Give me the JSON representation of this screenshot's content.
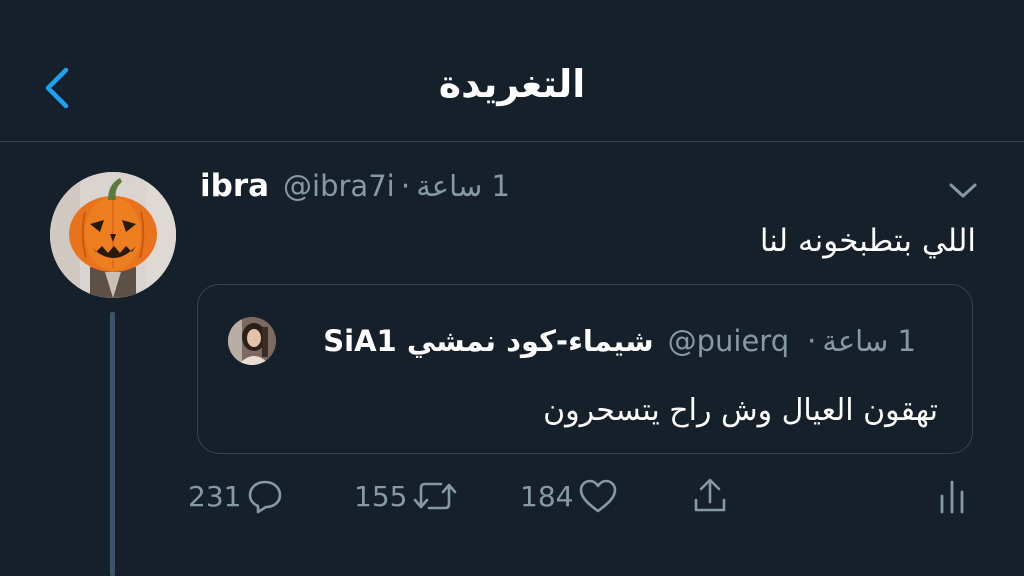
{
  "header": {
    "title": "التغريدة"
  },
  "tweet": {
    "name": "ibra",
    "handle": "@ibra7i",
    "time": "1 ساعة",
    "text": "اللي بتطبخونه لنا",
    "avatar": "pumpkin-avatar"
  },
  "quote": {
    "name": "شيماء-كود نمشي SiA1",
    "handle": "@puierq",
    "time": "1 ساعة",
    "text": "تهقون العيال وش راح يتسحرون",
    "avatar": "woman-avatar"
  },
  "actions": {
    "replies": "231",
    "retweets": "155",
    "likes": "184"
  },
  "icons": {
    "back": "chevron-left-icon",
    "caret": "chevron-down-icon",
    "reply": "reply-bubble-icon",
    "retweet": "retweet-icon",
    "like": "heart-icon",
    "share": "share-icon",
    "analytics": "analytics-icon"
  },
  "colors": {
    "background": "#15202b",
    "accent": "#1da1f2",
    "secondary_text": "#8899a6",
    "border": "#38444d"
  }
}
